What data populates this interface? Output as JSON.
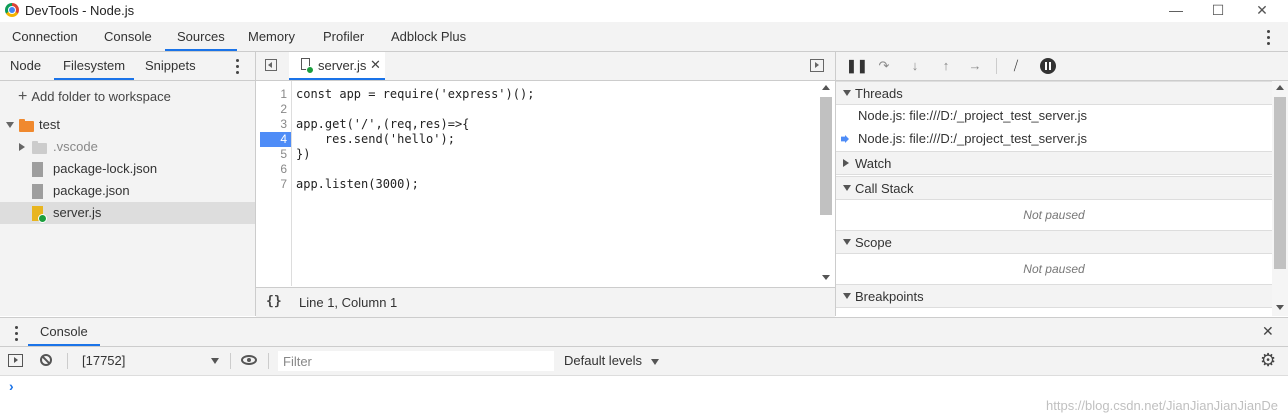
{
  "window": {
    "title": "DevTools - Node.js"
  },
  "main_tabs": [
    {
      "label": "Connection"
    },
    {
      "label": "Console"
    },
    {
      "label": "Sources",
      "active": true
    },
    {
      "label": "Memory"
    },
    {
      "label": "Profiler"
    },
    {
      "label": "Adblock Plus"
    }
  ],
  "navigator": {
    "tabs": [
      {
        "label": "Node"
      },
      {
        "label": "Filesystem",
        "active": true
      },
      {
        "label": "Snippets"
      }
    ],
    "add_folder_label": "Add folder to workspace",
    "tree": [
      {
        "label": "test",
        "type": "folder",
        "expanded": true
      },
      {
        "label": ".vscode",
        "type": "folder",
        "expanded": false
      },
      {
        "label": "package-lock.json",
        "type": "file"
      },
      {
        "label": "package.json",
        "type": "file"
      },
      {
        "label": "server.js",
        "type": "file",
        "selected": true
      }
    ]
  },
  "editor": {
    "tab_label": "server.js",
    "line_numbers": [
      "1",
      "2",
      "3",
      "4",
      "5",
      "6",
      "7"
    ],
    "code_lines": [
      "const app = require('express')();",
      "",
      "app.get('/',(req,res)=>{",
      "    res.send('hello');",
      "})",
      "",
      "app.listen(3000);"
    ],
    "breakpoint_line": 4,
    "status": "Line 1, Column 1",
    "format_glyph": "{}"
  },
  "debugger": {
    "sections": {
      "threads": "Threads",
      "watch": "Watch",
      "call_stack": "Call Stack",
      "scope": "Scope",
      "breakpoints": "Breakpoints"
    },
    "threads": [
      {
        "label": "Node.js: file:///D:/_project_test_server.js",
        "current": false
      },
      {
        "label": "Node.js: file:///D:/_project_test_server.js",
        "current": true
      }
    ],
    "not_paused": "Not paused"
  },
  "drawer": {
    "tab_label": "Console",
    "context": "[17752]",
    "filter_placeholder": "Filter",
    "levels": "Default levels",
    "prompt": "›"
  },
  "watermark": "https://blog.csdn.net/JianJianJianJianDe",
  "colors": {
    "accent": "#1a73e8",
    "breakpoint": "#4e8cf7",
    "folder": "#f0892e"
  }
}
